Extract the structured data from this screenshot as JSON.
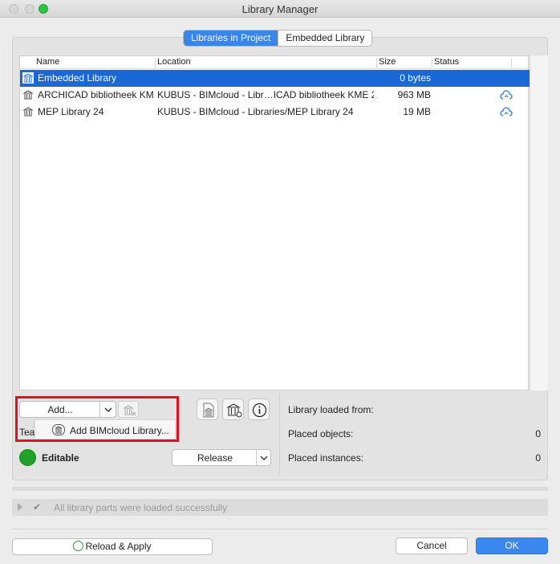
{
  "window": {
    "title": "Library Manager"
  },
  "tabs": [
    {
      "label": "Libraries in Project",
      "active": true
    },
    {
      "label": "Embedded Library",
      "active": false
    }
  ],
  "table": {
    "columns": [
      "Name",
      "Location",
      "Size",
      "Status"
    ],
    "rows": [
      {
        "name": "Embedded Library",
        "location": "",
        "size": "0 bytes",
        "status_icon": "",
        "selected": true
      },
      {
        "name": "ARCHICAD bibliotheek KM…",
        "location": "KUBUS - BIMcloud - Libr…ICAD bibliotheek KME 24",
        "size": "963 MB",
        "status_icon": "cloud-sync-icon",
        "selected": false
      },
      {
        "name": "MEP Library 24",
        "location": "KUBUS - BIMcloud - Libraries/MEP Library 24",
        "size": "19 MB",
        "status_icon": "cloud-sync-icon",
        "selected": false
      }
    ]
  },
  "add": {
    "label": "Add...",
    "menu_item": "Add BIMcloud Library...",
    "team_label_partial": "Tea"
  },
  "team": {
    "status": "Editable",
    "release_label": "Release"
  },
  "info": {
    "loaded_from_label": "Library loaded from:",
    "placed_objects_label": "Placed objects:",
    "placed_objects_value": "0",
    "placed_instances_label": "Placed instances:",
    "placed_instances_value": "0"
  },
  "status_message": "All library parts were loaded successfully",
  "footer": {
    "reload_label": "Reload & Apply",
    "cancel_label": "Cancel",
    "ok_label": "OK"
  },
  "colors": {
    "accent": "#3a85e8",
    "selection": "#1a67d6",
    "status_green": "#1fa12a",
    "highlight_red": "#e01020"
  }
}
